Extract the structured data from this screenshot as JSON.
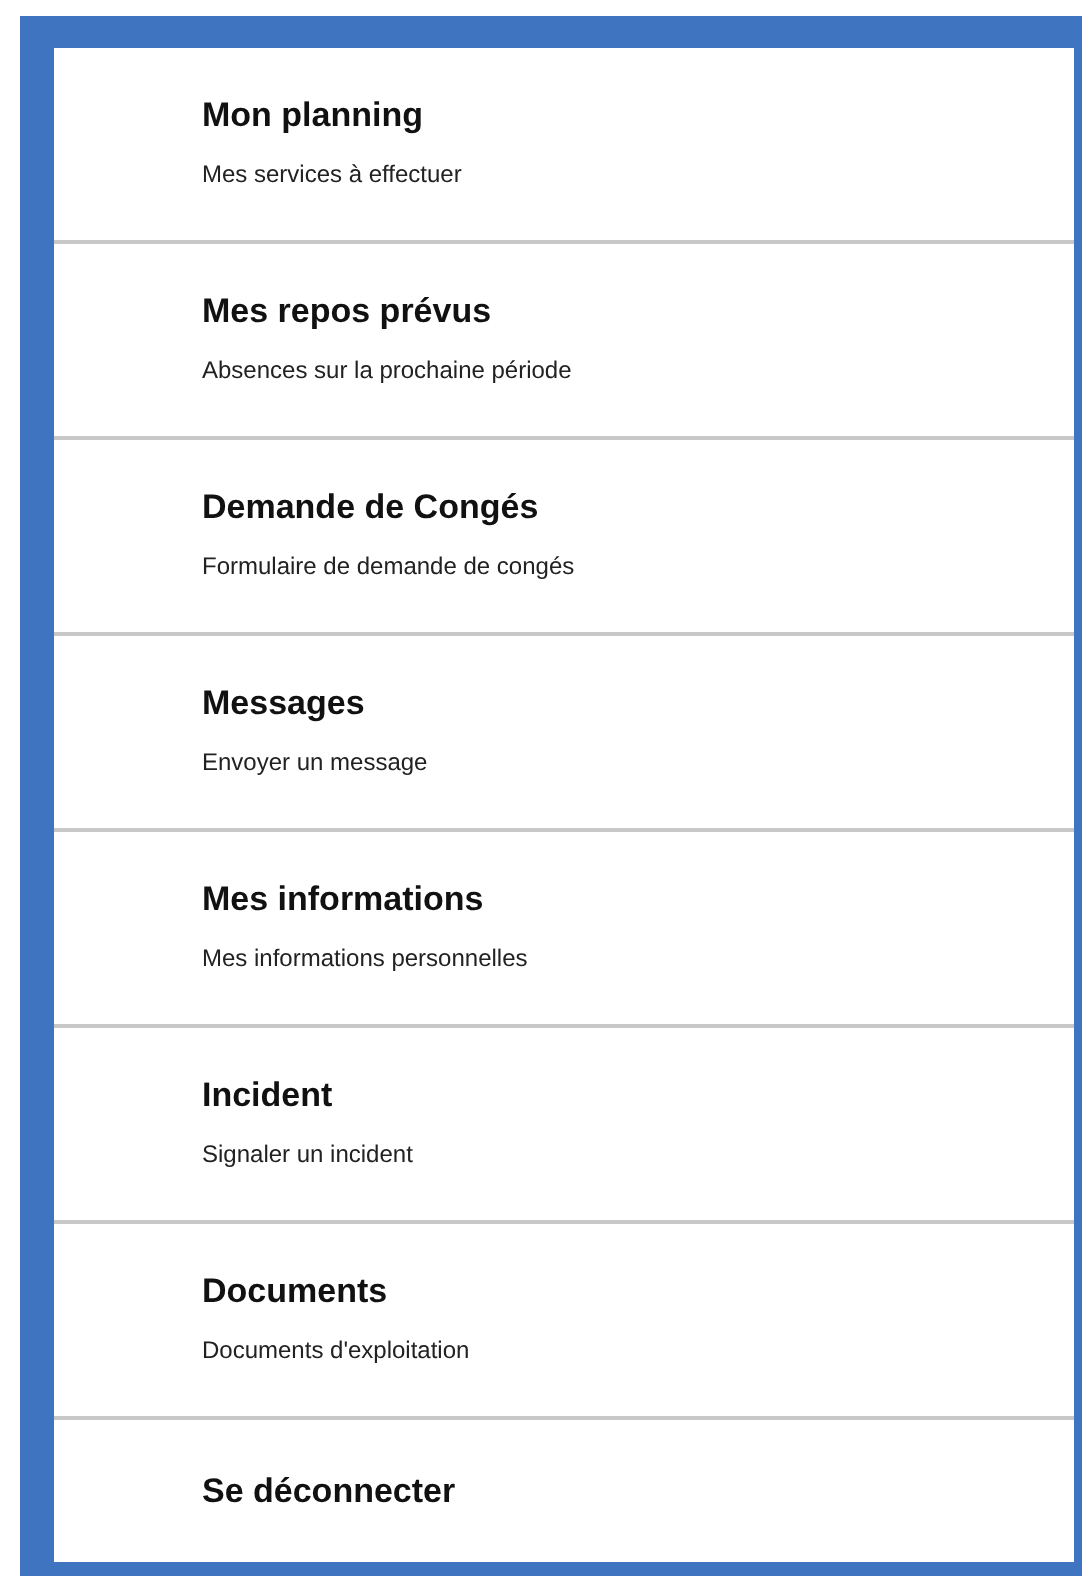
{
  "menu": {
    "items": [
      {
        "title": "Mon planning",
        "subtitle": "Mes services à effectuer"
      },
      {
        "title": "Mes repos prévus",
        "subtitle": "Absences sur la prochaine période"
      },
      {
        "title": "Demande de Congés",
        "subtitle": "Formulaire de demande de congés"
      },
      {
        "title": "Messages",
        "subtitle": "Envoyer un message"
      },
      {
        "title": "Mes informations",
        "subtitle": "Mes informations personnelles"
      },
      {
        "title": "Incident",
        "subtitle": "Signaler un incident"
      },
      {
        "title": "Documents",
        "subtitle": "Documents d'exploitation"
      },
      {
        "title": "Se déconnecter"
      }
    ]
  }
}
